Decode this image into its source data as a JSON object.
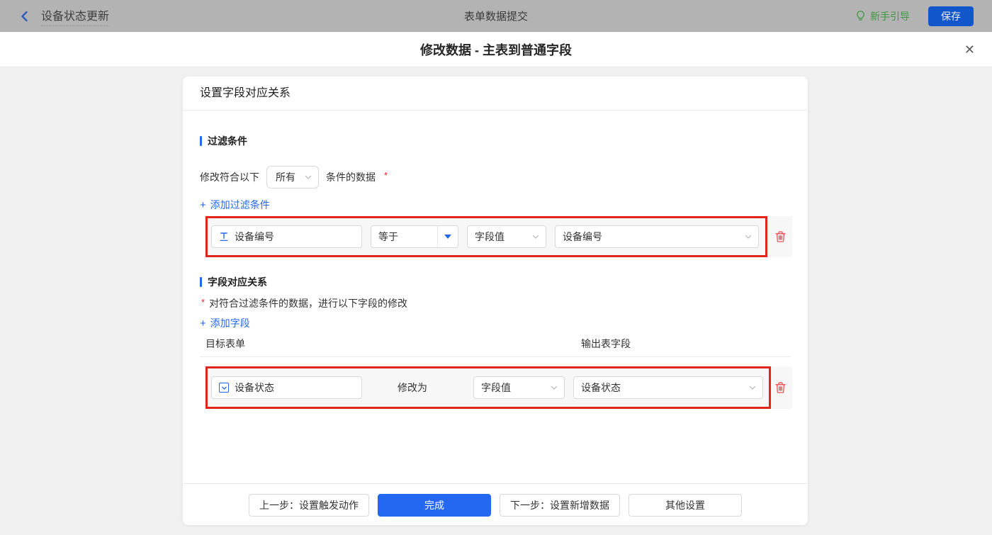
{
  "topbar": {
    "back_label": "设备状态更新",
    "center_title": "表单数据提交",
    "guide_label": "新手引导",
    "save_label": "保存"
  },
  "modal": {
    "title": "修改数据 - 主表到普通字段",
    "close_glyph": "✕"
  },
  "panel": {
    "header": "设置字段对应关系",
    "filter": {
      "section_title": "过滤条件",
      "match_prefix": "修改符合以下",
      "match_value": "所有",
      "match_suffix": "条件的数据",
      "required_mark": "*",
      "add_plus": "+",
      "add_label": "添加过滤条件",
      "row": {
        "field": "设备编号",
        "field_icon_glyph": "T",
        "operator": "等于",
        "value_type": "字段值",
        "value_field": "设备编号"
      }
    },
    "mapping": {
      "section_title": "字段对应关系",
      "required_mark": "*",
      "description": "对符合过滤条件的数据，进行以下字段的修改",
      "add_plus": "+",
      "add_label": "添加字段",
      "col_target": "目标表单",
      "col_output": "输出表字段",
      "row": {
        "field": "设备状态",
        "action_label": "修改为",
        "value_type": "字段值",
        "value_field": "设备状态"
      }
    },
    "footer": {
      "prev": "上一步：设置触发动作",
      "done": "完成",
      "next": "下一步：设置新增数据",
      "other": "其他设置"
    }
  },
  "colors": {
    "primary_blue": "#2468f2",
    "highlight_red": "#e1251b",
    "trash_red": "#f05050",
    "guide_green": "#3f9743",
    "topbar_dim_gray": "#b3b3b3",
    "page_bg": "#f0f0f0"
  }
}
